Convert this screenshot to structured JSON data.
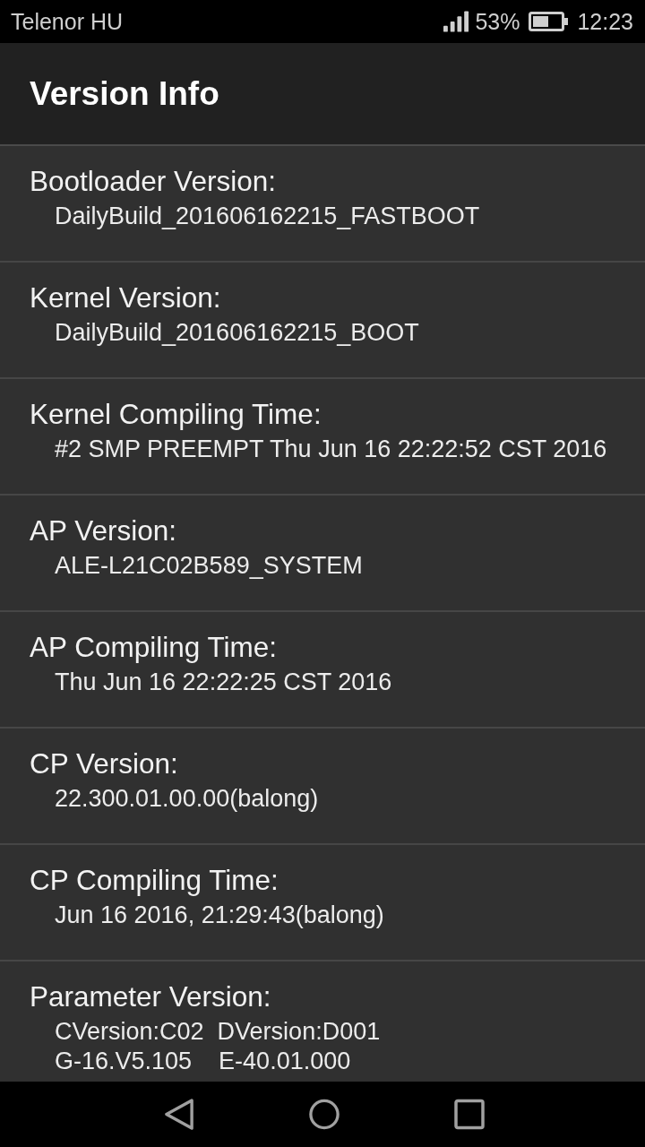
{
  "status_bar": {
    "carrier": "Telenor HU",
    "battery": "53%",
    "time": "12:23"
  },
  "app_bar": {
    "title": "Version Info"
  },
  "items": [
    {
      "label": "Bootloader Version:",
      "value_lines": [
        "DailyBuild_201606162215_FASTBOOT"
      ]
    },
    {
      "label": "Kernel Version:",
      "value_lines": [
        "DailyBuild_201606162215_BOOT"
      ]
    },
    {
      "label": "Kernel Compiling Time:",
      "value_lines": [
        "#2 SMP PREEMPT Thu Jun 16 22:22:52 CST 2016"
      ]
    },
    {
      "label": "AP Version:",
      "value_lines": [
        "ALE-L21C02B589_SYSTEM"
      ]
    },
    {
      "label": "AP Compiling Time:",
      "value_lines": [
        "Thu Jun 16 22:22:25 CST 2016"
      ]
    },
    {
      "label": "CP Version:",
      "value_lines": [
        "22.300.01.00.00(balong)"
      ]
    },
    {
      "label": "CP Compiling Time:",
      "value_lines": [
        "Jun 16 2016, 21:29:43(balong)"
      ]
    },
    {
      "label": "Parameter Version:",
      "value_lines": [
        "CVersion:C02  DVersion:D001",
        "G-16.V5.105    E-40.01.000"
      ]
    }
  ]
}
